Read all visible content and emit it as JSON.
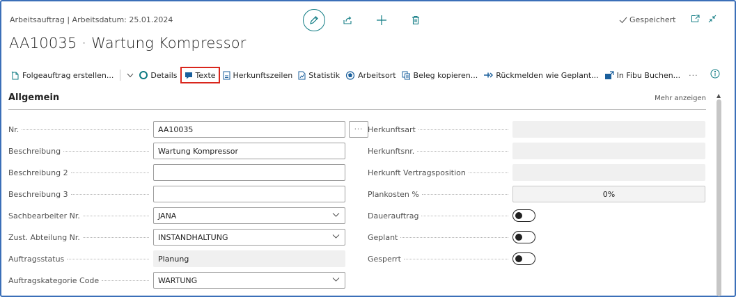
{
  "header": {
    "context": "Arbeitsauftrag | Arbeitsdatum: 25.01.2024",
    "title": "AA10035 · Wartung Kompressor",
    "status": "Gespeichert"
  },
  "toolbar": {
    "items": [
      {
        "label": "Folgeauftrag erstellen...",
        "icon": "new-document-icon"
      },
      {
        "label": "Details",
        "icon": "details-icon"
      },
      {
        "label": "Texte",
        "icon": "texts-icon"
      },
      {
        "label": "Herkunftszeilen",
        "icon": "lines-document-icon"
      },
      {
        "label": "Statistik",
        "icon": "statistics-icon"
      },
      {
        "label": "Arbeitsort",
        "icon": "location-icon"
      },
      {
        "label": "Beleg kopieren...",
        "icon": "copy-document-icon"
      },
      {
        "label": "Rückmelden wie Geplant...",
        "icon": "report-plan-icon"
      },
      {
        "label": "In Fibu Buchen...",
        "icon": "post-icon"
      }
    ],
    "more": "···",
    "highlight_color": "#d9261c"
  },
  "section": {
    "title": "Allgemein",
    "more_link": "Mehr anzeigen"
  },
  "left_fields": [
    {
      "label": "Nr.",
      "value": "AA10035",
      "type": "lookup"
    },
    {
      "label": "Beschreibung",
      "value": "Wartung Kompressor",
      "type": "text"
    },
    {
      "label": "Beschreibung 2",
      "value": "",
      "type": "text"
    },
    {
      "label": "Beschreibung 3",
      "value": "",
      "type": "text"
    },
    {
      "label": "Sachbearbeiter Nr.",
      "value": "JANA",
      "type": "select"
    },
    {
      "label": "Zust. Abteilung Nr.",
      "value": "INSTANDHALTUNG",
      "type": "select"
    },
    {
      "label": "Auftragsstatus",
      "value": "Planung",
      "type": "readonly"
    },
    {
      "label": "Auftragskategorie Code",
      "value": "WARTUNG",
      "type": "select"
    }
  ],
  "right_fields": [
    {
      "label": "Herkunftsart",
      "value": "",
      "type": "readonly"
    },
    {
      "label": "Herkunftsnr.",
      "value": "",
      "type": "readonly"
    },
    {
      "label": "Herkunft Vertragsposition",
      "value": "",
      "type": "readonly"
    },
    {
      "label": "Plankosten %",
      "value": "0%",
      "type": "percent"
    },
    {
      "label": "Dauerauftrag",
      "value": false,
      "type": "toggle"
    },
    {
      "label": "Geplant",
      "value": false,
      "type": "toggle"
    },
    {
      "label": "Gesperrt",
      "value": false,
      "type": "toggle"
    }
  ],
  "colors": {
    "accent": "#0f7b83",
    "frame": "#3b6fb8"
  }
}
